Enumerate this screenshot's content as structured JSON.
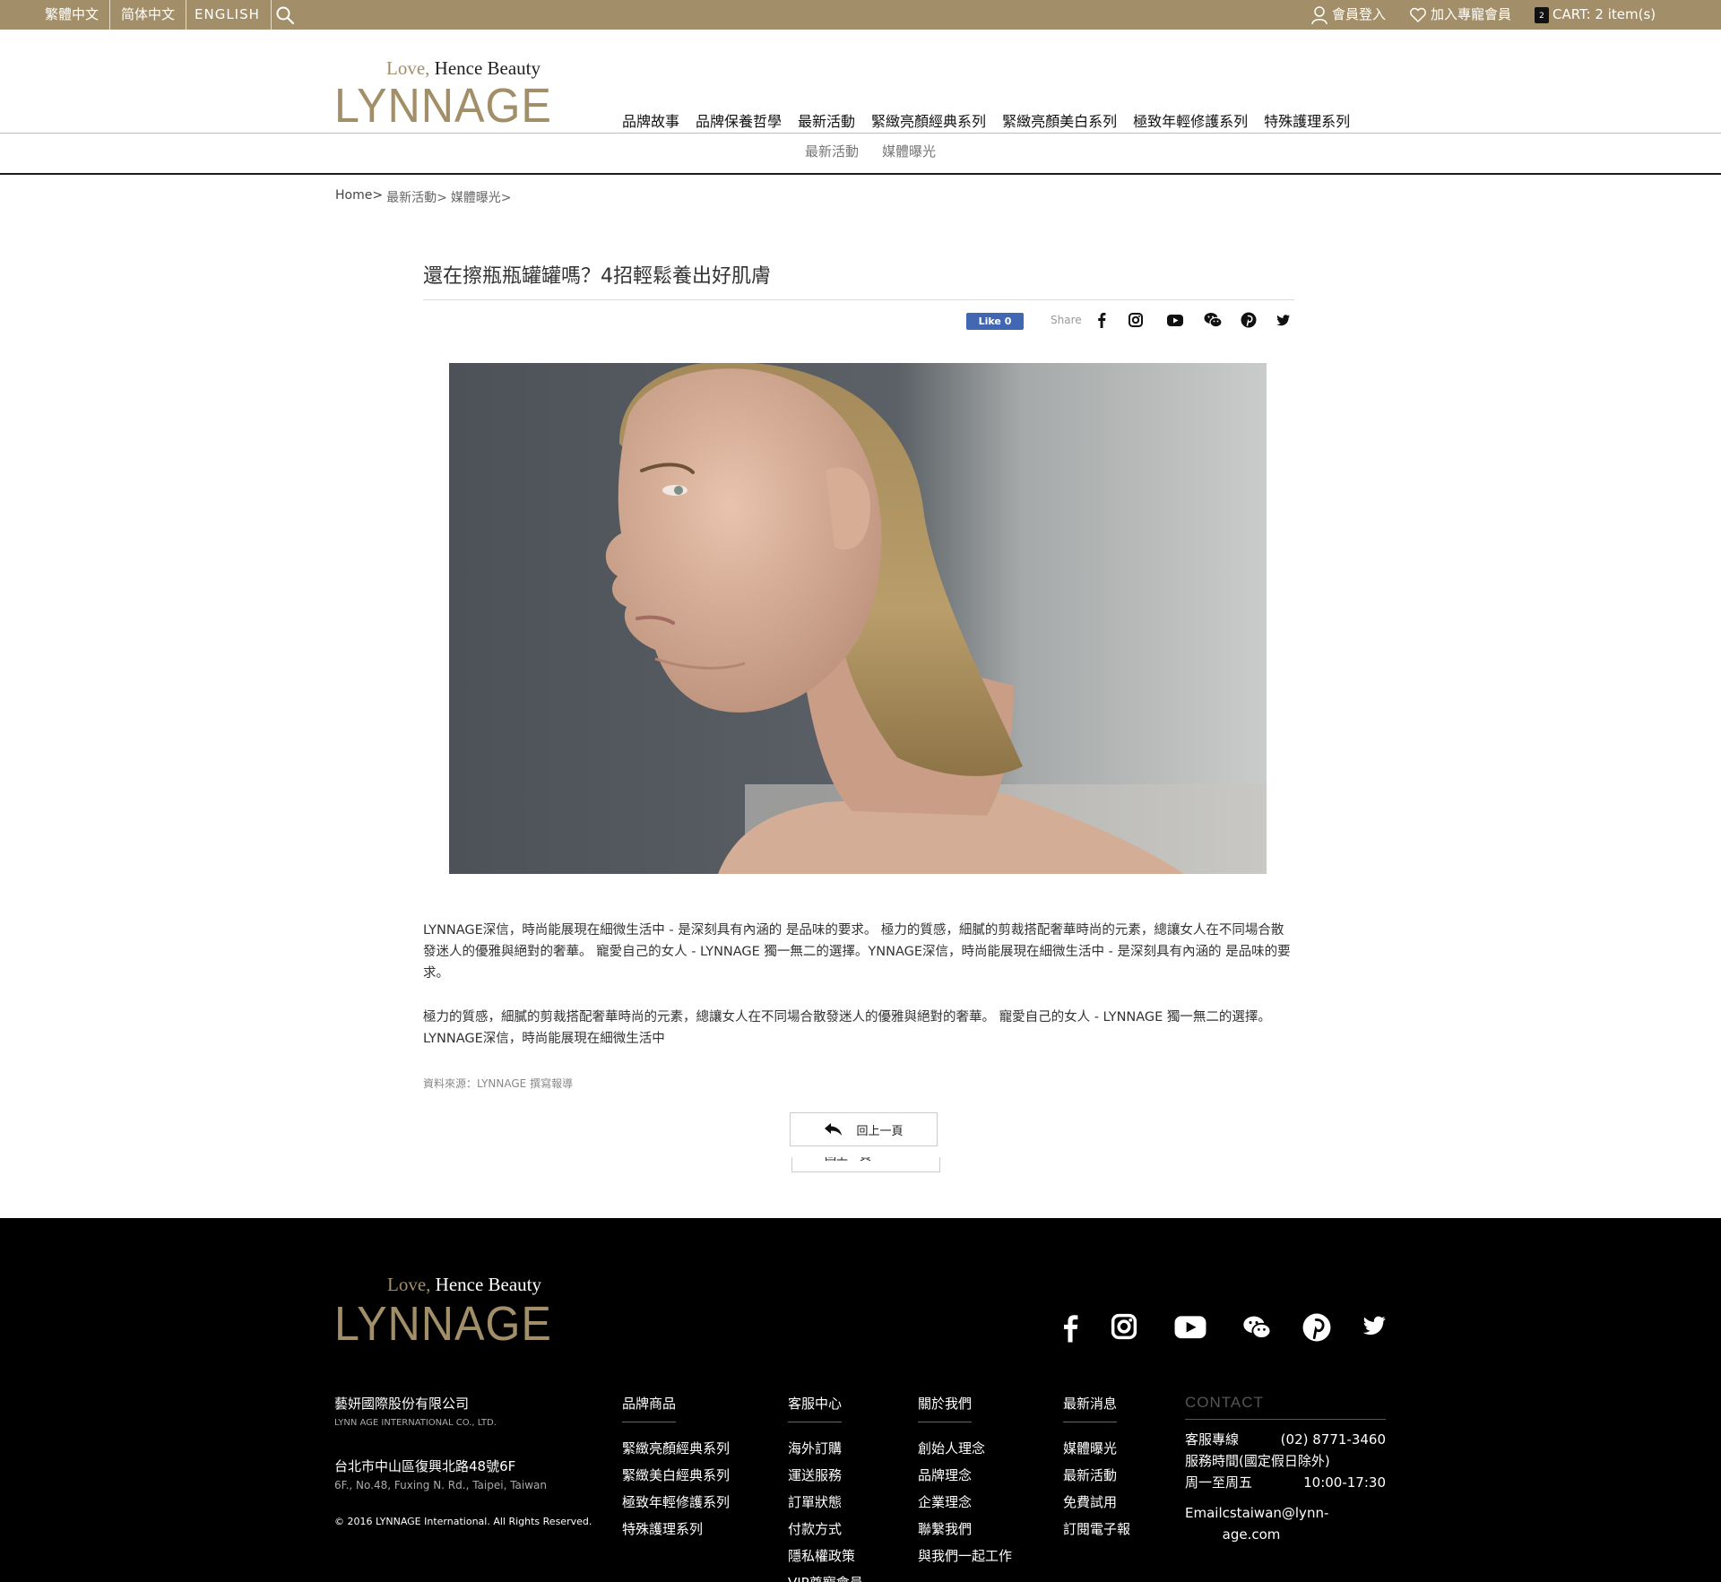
{
  "topbar": {
    "languages": [
      "繁體中文",
      "简体中文",
      "ENGLISH"
    ],
    "login": "會員登入",
    "vip": "加入專寵會員",
    "cart_count": "2",
    "cart": "CART: 2 item(s)"
  },
  "logo": {
    "tagline_love": "Love,",
    "tagline_rest": "Hence Beauty",
    "word": "LYNNAGE"
  },
  "nav": [
    "品牌故事",
    "品牌保養哲學",
    "最新活動",
    "緊緻亮顏經典系列",
    "緊緻亮顏美白系列",
    "極致年輕修護系列",
    "特殊護理系列"
  ],
  "subnav": [
    "最新活動",
    "媒體曝光"
  ],
  "breadcrumb": [
    "Home>",
    "最新活動>",
    "媒體曝光>"
  ],
  "article": {
    "title": "還在擦瓶瓶罐罐嗎？4招輕鬆養出好肌膚",
    "like": "Like 0",
    "share": "Share",
    "share_icons": [
      "facebook-icon",
      "instagram-icon",
      "youtube-icon",
      "wechat-icon",
      "pinterest-icon",
      "twitter-icon"
    ],
    "p1": "LYNNAGE深信，時尚能展現在細微生活中 - 是深刻具有內涵的 是品味的要求。 極力的質感，細膩的剪裁搭配奢華時尚的元素，總讓女人在不同場合散發迷人的優雅與絕對的奢華。 寵愛自己的女人 - LYNNAGE 獨一無二的選擇。YNNAGE深信，時尚能展現在細微生活中 - 是深刻具有內涵的 是品味的要求。",
    "p2": "極力的質感，細膩的剪裁搭配奢華時尚的元素，總讓女人在不同場合散發迷人的優雅與絕對的奢華。 寵愛自己的女人 - LYNNAGE 獨一無二的選擇。LYNNAGE深信，時尚能展現在細微生活中",
    "source": "資料來源：LYNNAGE 撰寫報導",
    "back": "回上一頁"
  },
  "footer": {
    "company_cn": "藝妍國際股份有限公司",
    "company_en": "LYNN AGE INTERNATIONAL CO., LTD.",
    "addr_cn": "台北市中山區復興北路48號6F",
    "addr_en": "6F., No.48, Fuxing N. Rd., Taipei, Taiwan",
    "copyright": "© 2016 LYNNAGE International. All Rights Reserved.",
    "cols": [
      {
        "head": "品牌商品",
        "items": [
          "緊緻亮顏經典系列",
          "緊緻美白經典系列",
          "極致年輕修護系列",
          "特殊護理系列"
        ]
      },
      {
        "head": "客服中心",
        "items": [
          "海外訂購",
          "運送服務",
          "訂單狀態",
          "付款方式",
          "隱私權政策",
          "VIP尊寵會員"
        ]
      },
      {
        "head": "關於我們",
        "items": [
          "創始人理念",
          "品牌理念",
          "企業理念",
          "聯繫我們",
          "與我們一起工作"
        ]
      },
      {
        "head": "最新消息",
        "items": [
          "媒體曝光",
          "最新活動",
          "免費試用",
          "訂閱電子報"
        ]
      }
    ],
    "contact": {
      "head": "CONTACT",
      "hotline_label": "客服專線",
      "hotline": "(02) 8771-3460",
      "hours_label": "服務時間(國定假日除外)",
      "days": "周一至周五",
      "hours": "10:00-17:30",
      "email_label": "Email",
      "email": "cstaiwan@lynn-age.com"
    }
  },
  "colors": {
    "gold": "#a28f69",
    "footer_bg": "#000000",
    "like_blue": "#4267b2"
  }
}
